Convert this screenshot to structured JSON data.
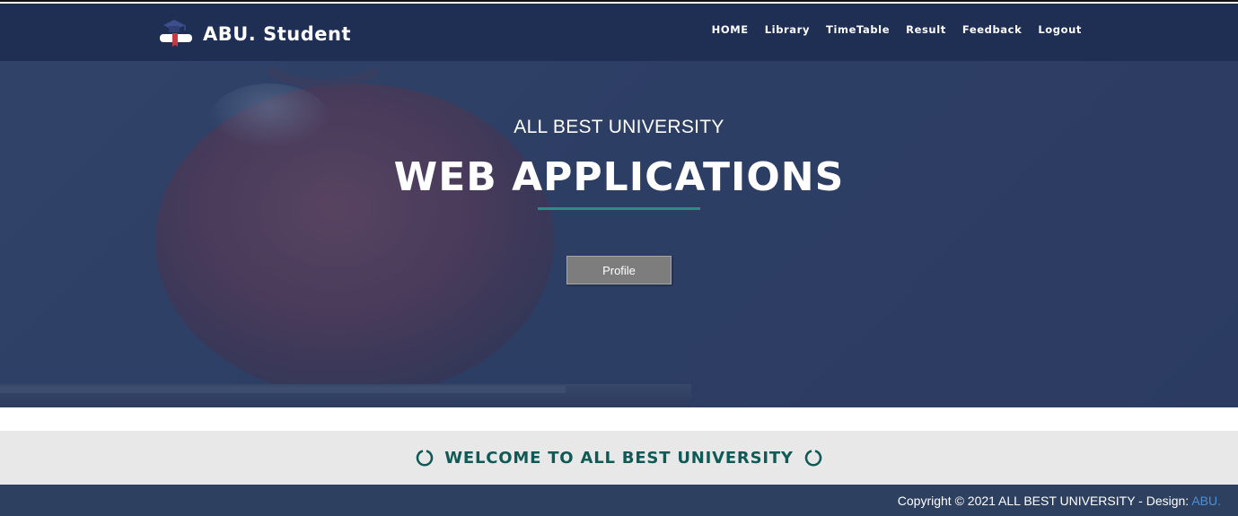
{
  "header": {
    "brand_title": "ABU. Student",
    "brand_icon": "graduation-cap-icon",
    "nav": [
      {
        "label": "HOME"
      },
      {
        "label": "Library"
      },
      {
        "label": "TimeTable"
      },
      {
        "label": "Result"
      },
      {
        "label": "Feedback"
      },
      {
        "label": "Logout"
      }
    ]
  },
  "hero": {
    "subtitle": "ALL BEST UNIVERSITY",
    "title": "WEB APPLICATIONS",
    "profile_button": "Profile",
    "accent_color": "#2e8b86"
  },
  "welcome": {
    "text": "WELCOME TO ALL BEST UNIVERSITY",
    "icon": "spinner-icon"
  },
  "footer": {
    "copyright_prefix": "Copyright © 2021 ALL BEST UNIVERSITY - Design: ",
    "design_link": "ABU."
  },
  "colors": {
    "header_bg": "#1f2e53",
    "footer_bg": "#2e4060",
    "welcome_text": "#0f5a56",
    "link": "#4f8fd6"
  }
}
